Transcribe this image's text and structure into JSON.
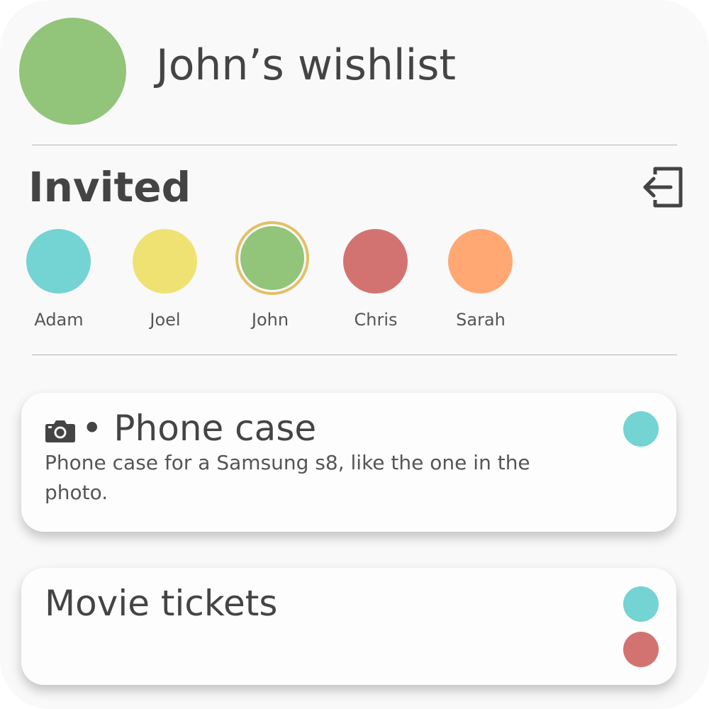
{
  "header": {
    "title": "John’s wishlist",
    "owner_avatar_color": "#92c47a"
  },
  "invited": {
    "title": "Invited",
    "leave_icon": "exit-icon",
    "members": [
      {
        "name": "Adam",
        "color": "#74d3d3",
        "selected": false
      },
      {
        "name": "Joel",
        "color": "#efe273",
        "selected": false
      },
      {
        "name": "John",
        "color": "#92c47a",
        "selected": true,
        "ring_color": "#e2c06a"
      },
      {
        "name": "Chris",
        "color": "#d37371",
        "selected": false
      },
      {
        "name": "Sarah",
        "color": "#ffa874",
        "selected": false
      }
    ]
  },
  "wishlist": {
    "items": [
      {
        "icon": "camera-icon",
        "separator": "•",
        "title": "Phone case",
        "description": "Phone case for a Samsung s8, like the one in the photo.",
        "claimed_by_colors": [
          "#74d3d3"
        ]
      },
      {
        "title": "Movie tickets",
        "description": "",
        "claimed_by_colors": [
          "#74d3d3",
          "#d37371"
        ]
      }
    ]
  }
}
